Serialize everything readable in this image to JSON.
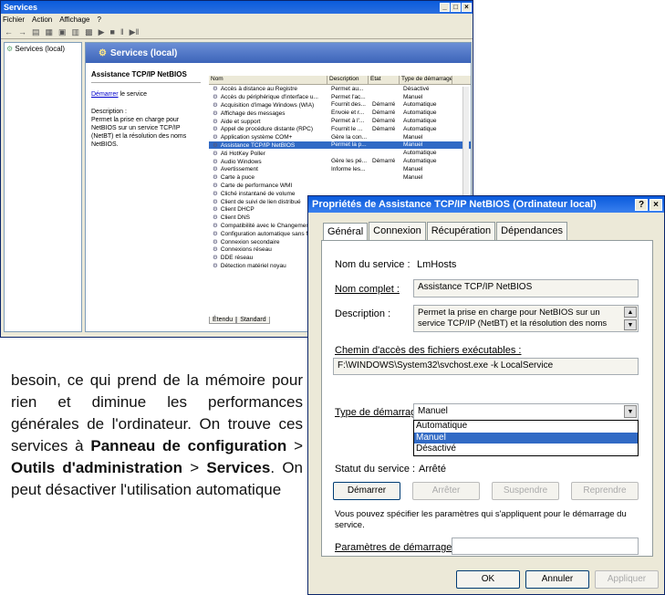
{
  "window": {
    "title": "Services",
    "menu": [
      "Fichier",
      "Action",
      "Affichage",
      "?"
    ],
    "tree_root": "Services (local)",
    "panel_title": "Services (local)"
  },
  "left_pane": {
    "service_title": "Assistance TCP/IP NetBIOS",
    "start_link": "Démarrer",
    "start_link_rest": " le service",
    "desc_label": "Description :",
    "desc_text": "Permet la prise en charge pour NetBIOS sur un service TCP/IP (NetBT) et la résolution des noms NetBIOS."
  },
  "columns": [
    "Nom",
    "Description",
    "État",
    "Type de démarrage"
  ],
  "rows": [
    [
      "Accès à distance au Registre",
      "Permet au...",
      "",
      "Désactivé"
    ],
    [
      "Accès du périphérique d'interface u...",
      "Permet l'ac...",
      "",
      "Manuel"
    ],
    [
      "Acquisition d'image Windows (WIA)",
      "Fournit des...",
      "Démarré",
      "Automatique"
    ],
    [
      "Affichage des messages",
      "Envoie et r...",
      "Démarré",
      "Automatique"
    ],
    [
      "Aide et support",
      "Permet à l'...",
      "Démarré",
      "Automatique"
    ],
    [
      "Appel de procédure distante (RPC)",
      "Fournit le ...",
      "Démarré",
      "Automatique"
    ],
    [
      "Application système COM+",
      "Gère la con...",
      "",
      "Manuel"
    ],
    [
      "Assistance TCP/IP NetBIOS",
      "Permet la p...",
      "",
      "Manuel"
    ],
    [
      "Ati HotKey Poller",
      "",
      "",
      "Automatique"
    ],
    [
      "Audio Windows",
      "Gère les pé...",
      "Démarré",
      "Automatique"
    ],
    [
      "Avertissement",
      "Informe les...",
      "",
      "Manuel"
    ],
    [
      "Carte à puce",
      "",
      "",
      "Manuel"
    ],
    [
      "Carte de performance WMI",
      "",
      "",
      ""
    ],
    [
      "Cliché instantané de volume",
      "",
      "",
      ""
    ],
    [
      "Client de suivi de lien distribué",
      "",
      "",
      ""
    ],
    [
      "Client DHCP",
      "",
      "",
      ""
    ],
    [
      "Client DNS",
      "",
      "",
      ""
    ],
    [
      "Compatibilité avec le Changement",
      "",
      "",
      ""
    ],
    [
      "Configuration automatique sans fil",
      "",
      "",
      ""
    ],
    [
      "Connexion secondaire",
      "",
      "",
      ""
    ],
    [
      "Connexions réseau",
      "",
      "",
      ""
    ],
    [
      "DDE réseau",
      "",
      "",
      ""
    ],
    [
      "Détection matériel noyau",
      "",
      "",
      ""
    ]
  ],
  "selected_row": 7,
  "pane_tabs": [
    "Étendu",
    "Standard"
  ],
  "dialog": {
    "title": "Propriétés de Assistance TCP/IP NetBIOS (Ordinateur local)",
    "help": "?",
    "tabs": [
      "Général",
      "Connexion",
      "Récupération",
      "Dépendances"
    ],
    "service_name_label": "Nom du service :",
    "service_name": "LmHosts",
    "display_name_label": "Nom complet :",
    "display_name": "Assistance TCP/IP NetBIOS",
    "description_label": "Description :",
    "description": "Permet la prise en charge pour NetBIOS sur un service TCP/IP (NetBT) et la résolution des noms",
    "path_label": "Chemin d'accès des fichiers exécutables :",
    "path": "F:\\WINDOWS\\System32\\svchost.exe -k LocalService",
    "startup_label": "Type de démarrage :",
    "startup_value": "Manuel",
    "startup_options": [
      "Automatique",
      "Manuel",
      "Désactivé"
    ],
    "status_label": "Statut du service :",
    "status_value": "Arrêté",
    "btn_start": "Démarrer",
    "btn_stop": "Arrêter",
    "btn_pause": "Suspendre",
    "btn_resume": "Reprendre",
    "params_hint": "Vous pouvez spécifier les paramètres qui s'appliquent pour le démarrage du service.",
    "params_label": "Paramètres de démarrage :",
    "params_value": "",
    "ok": "OK",
    "cancel": "Annuler",
    "apply": "Appliquer"
  },
  "article": {
    "t1": "besoin, ce qui prend de la mémoire pour rien et diminue les performances générales de l'ordinateur. On trouve ces services à ",
    "b1": "Panneau de configuration",
    "sep1": " > ",
    "b2": "Outils d'administration",
    "sep2": " > ",
    "b3": "Services",
    "t2": ". On peut désactiver l'utilisation automatique"
  }
}
